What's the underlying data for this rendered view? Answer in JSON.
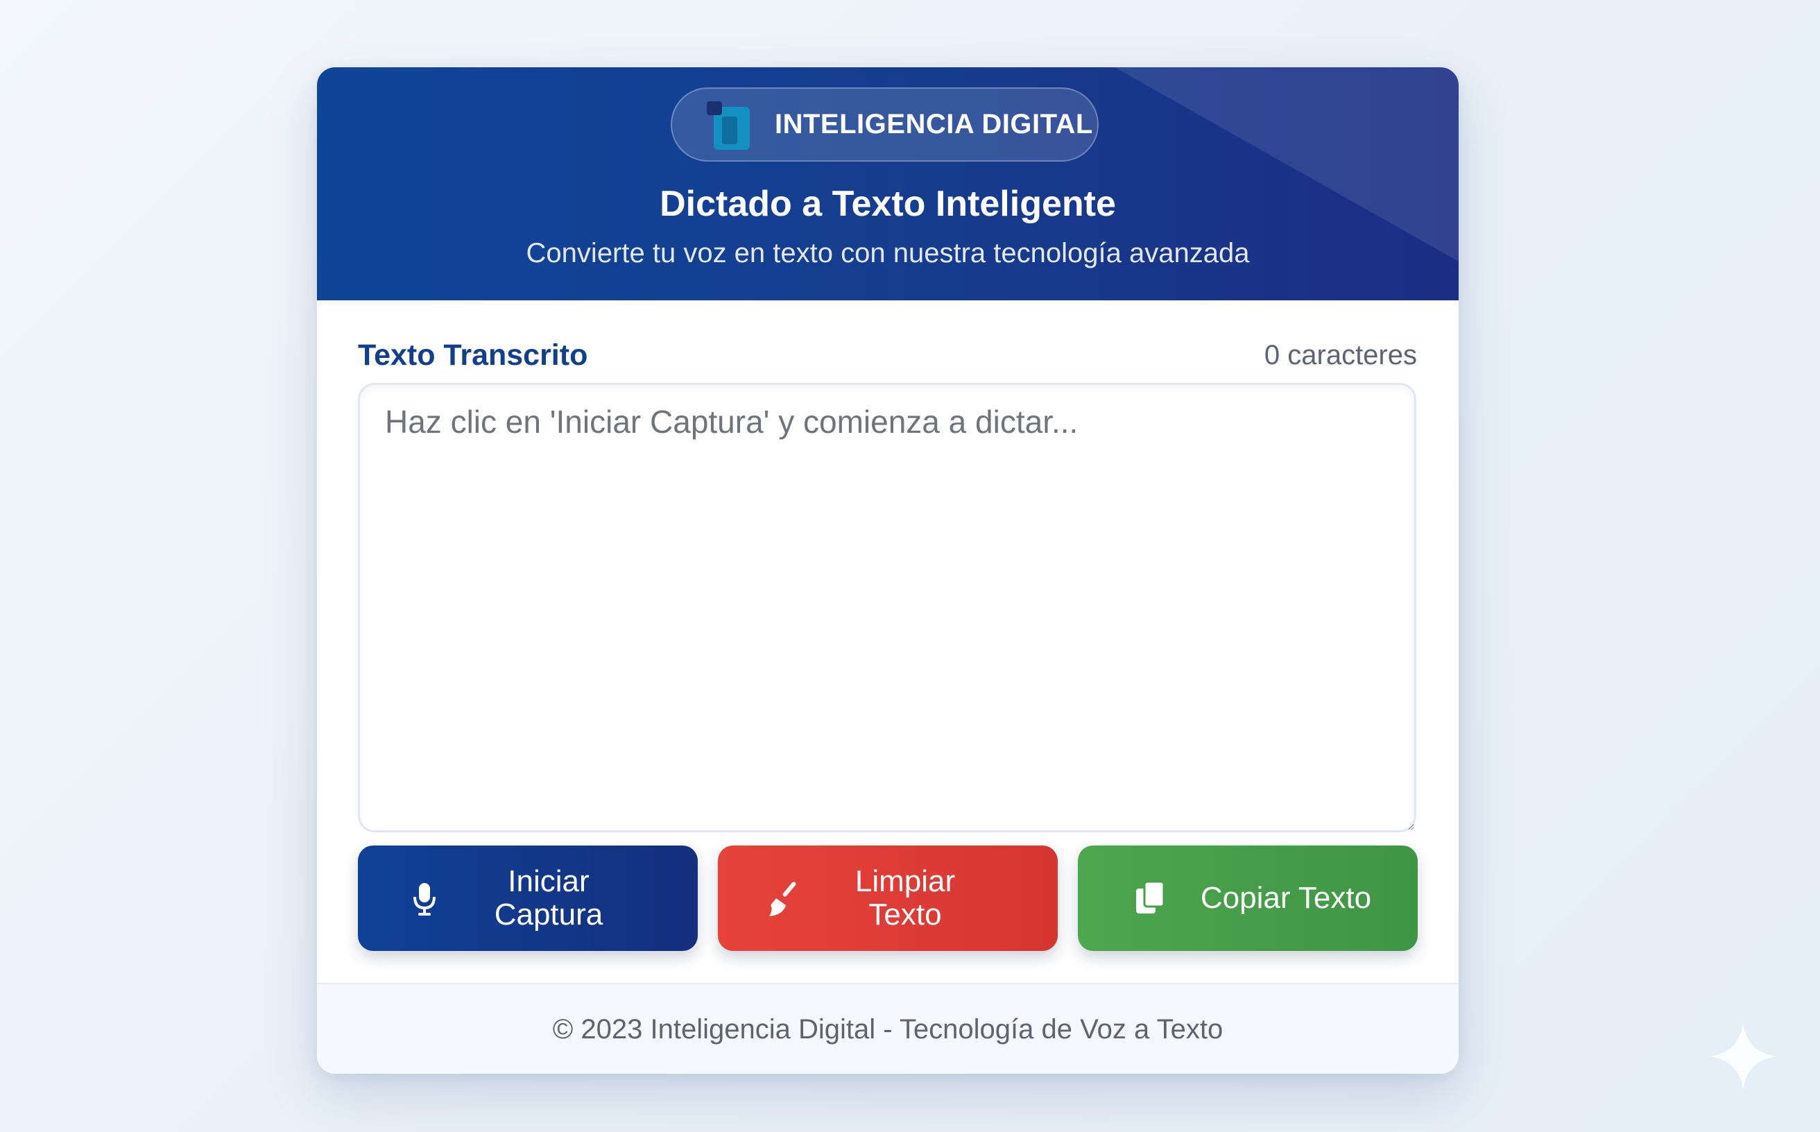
{
  "header": {
    "brand_name": "INTELIGENCIA DIGITAL",
    "title": "Dictado a Texto Inteligente",
    "subtitle": "Convierte tu voz en texto con nuestra tecnología avanzada"
  },
  "transcript": {
    "label": "Texto Transcrito",
    "char_count": "0 caracteres",
    "value": "",
    "placeholder": "Haz clic en 'Iniciar Captura' y comienza a dictar..."
  },
  "buttons": {
    "start_line1": "Iniciar",
    "start_line2": "Captura",
    "clear_line1": "Limpiar",
    "clear_line2": "Texto",
    "copy": "Copiar Texto"
  },
  "footer": {
    "text": "© 2023 Inteligencia Digital - Tecnología de Voz a Texto"
  },
  "icons": {
    "brand_logo": "brand-logo-icon",
    "start": "microphone-icon",
    "clear": "broom-icon",
    "copy": "copy-icon",
    "corner": "sparkle-icon"
  },
  "colors": {
    "primary_blue": "#123f8c",
    "header_start": "#0f4599",
    "header_end": "#1b2d84",
    "start_button": "#0f4196",
    "clear_button": "#e6433a",
    "copy_button": "#4ea64f"
  }
}
